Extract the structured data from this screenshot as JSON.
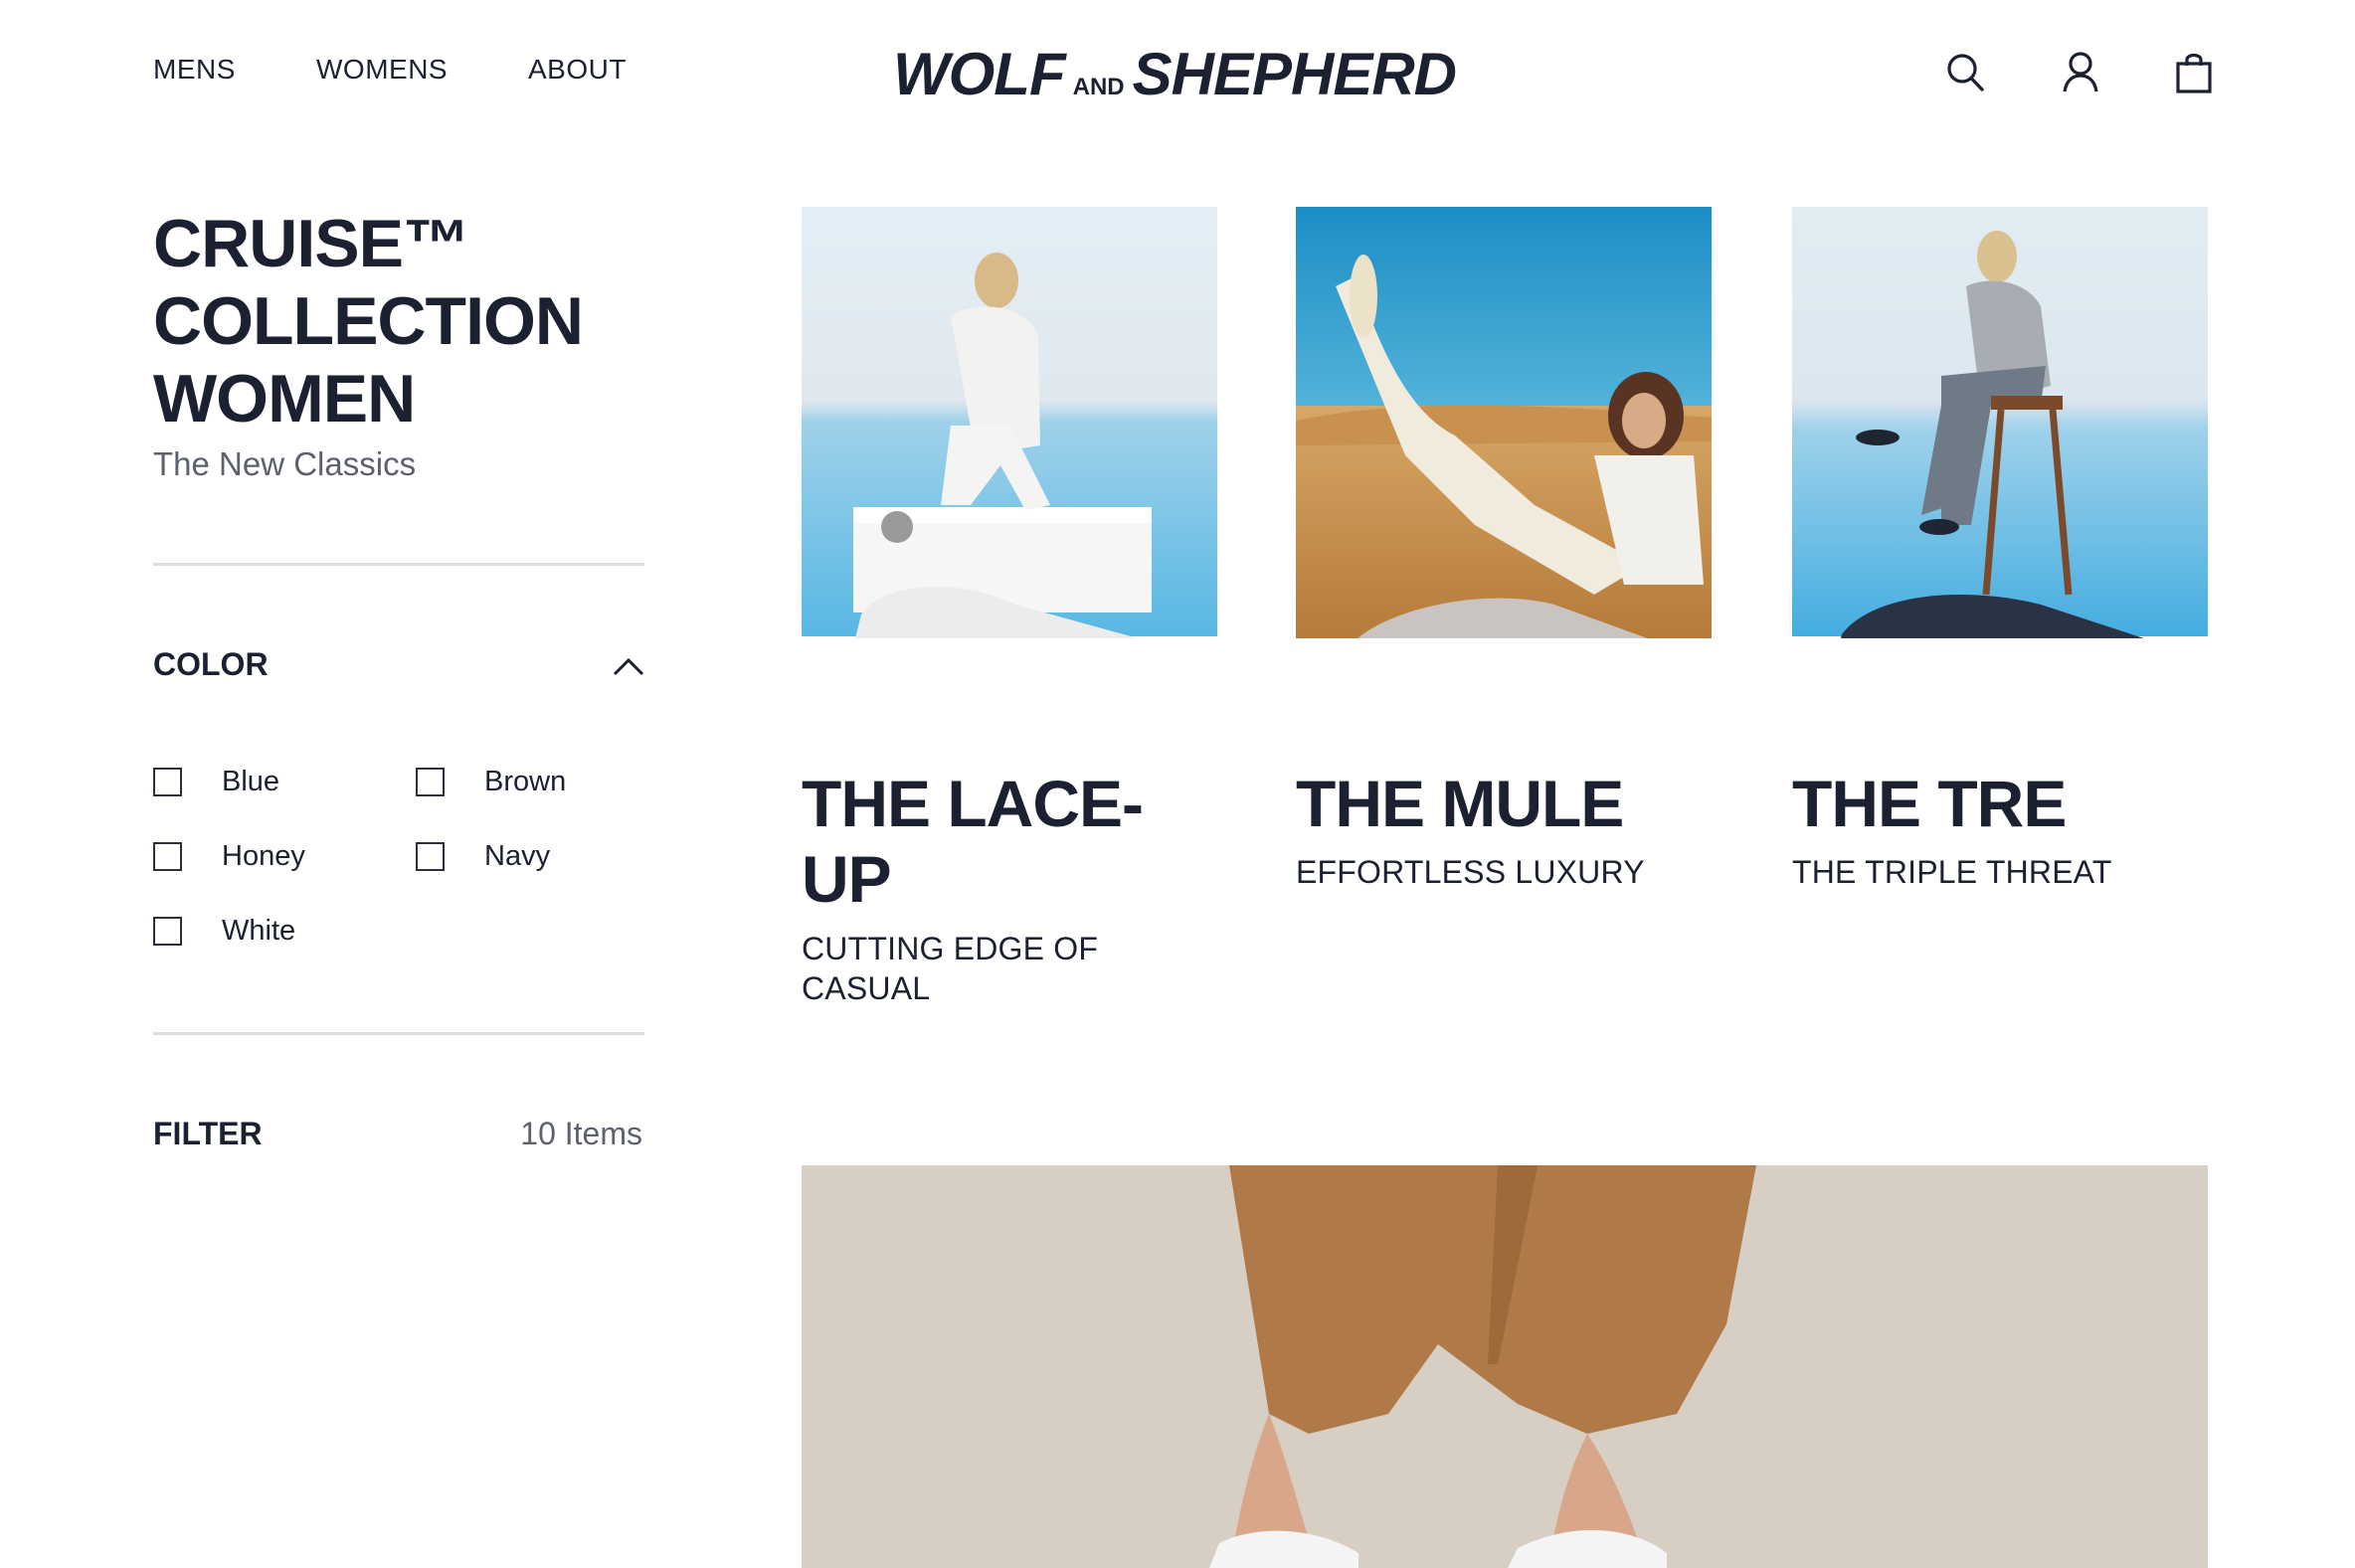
{
  "header": {
    "nav": [
      {
        "label": "MENS"
      },
      {
        "label": "WOMENS"
      },
      {
        "label": "ABOUT"
      }
    ],
    "logo": {
      "part1": "WOLF",
      "part2": "AND",
      "part3": "SHEPHERD"
    },
    "icons": [
      "search-icon",
      "account-icon",
      "bag-icon"
    ]
  },
  "sidebar": {
    "title_lines": [
      "CRUISE™",
      "COLLECTION",
      "WOMEN"
    ],
    "subtitle": "The New Classics",
    "color_filter": {
      "heading": "COLOR",
      "options": [
        {
          "label": "Blue",
          "checked": false
        },
        {
          "label": "Brown",
          "checked": false
        },
        {
          "label": "Honey",
          "checked": false
        },
        {
          "label": "Navy",
          "checked": false
        },
        {
          "label": "White",
          "checked": false
        }
      ]
    },
    "filter": {
      "label": "FILTER",
      "count": "10 Items"
    }
  },
  "products": [
    {
      "title_line1": "THE LACE-",
      "title_line2": "UP",
      "tagline_line1": "CUTTING EDGE OF",
      "tagline_line2": "CASUAL",
      "shoe_color": "#f1f1f1"
    },
    {
      "title_line1": "THE MULE",
      "title_line2": "",
      "tagline_line1": "EFFORTLESS LUXURY",
      "tagline_line2": "",
      "shoe_color": "#c9c4bf"
    },
    {
      "title_line1": "THE TRE",
      "title_line2": "",
      "tagline_line1": "THE TRIPLE THREAT",
      "tagline_line2": "",
      "shoe_color": "#2a3345"
    }
  ],
  "colors": {
    "text": "#1b2130",
    "muted": "#5d616b",
    "sky": "#4db3e0",
    "sand": "#c9914e",
    "hero_bg": "#d8cfc4",
    "pants": "#b07a48"
  }
}
